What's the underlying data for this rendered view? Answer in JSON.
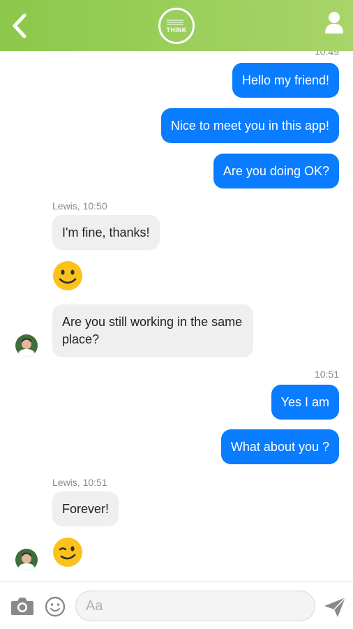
{
  "header": {
    "logo_text": "THINK",
    "accent_color": "#8cc84b"
  },
  "messages": [
    {
      "type": "timestamp",
      "side": "right",
      "text": "10:49"
    },
    {
      "type": "text",
      "side": "out",
      "text": "Hello my friend!"
    },
    {
      "type": "text",
      "side": "out",
      "text": "Nice to meet you in this app!"
    },
    {
      "type": "text",
      "side": "out",
      "text": "Are you doing OK?"
    },
    {
      "type": "timestamp",
      "side": "left",
      "text": "Lewis, 10:50"
    },
    {
      "type": "text",
      "side": "in",
      "text": "I'm fine, thanks!"
    },
    {
      "type": "emoji",
      "side": "in",
      "icon": "smiling-face-emoji"
    },
    {
      "type": "text",
      "side": "in",
      "text": "Are you still working in the same place?"
    },
    {
      "type": "timestamp",
      "side": "right",
      "text": "10:51"
    },
    {
      "type": "text",
      "side": "out",
      "text": "Yes I am"
    },
    {
      "type": "text",
      "side": "out",
      "text": "What about you ?"
    },
    {
      "type": "timestamp",
      "side": "left",
      "text": "Lewis, 10:51"
    },
    {
      "type": "text",
      "side": "in",
      "text": "Forever!"
    },
    {
      "type": "emoji",
      "side": "in",
      "icon": "winking-face-emoji"
    }
  ],
  "composer": {
    "placeholder": "Aa",
    "value": ""
  },
  "colors": {
    "outgoing_bubble": "#0a7cff",
    "incoming_bubble": "#efefef",
    "header_green": "#8cc84b"
  }
}
